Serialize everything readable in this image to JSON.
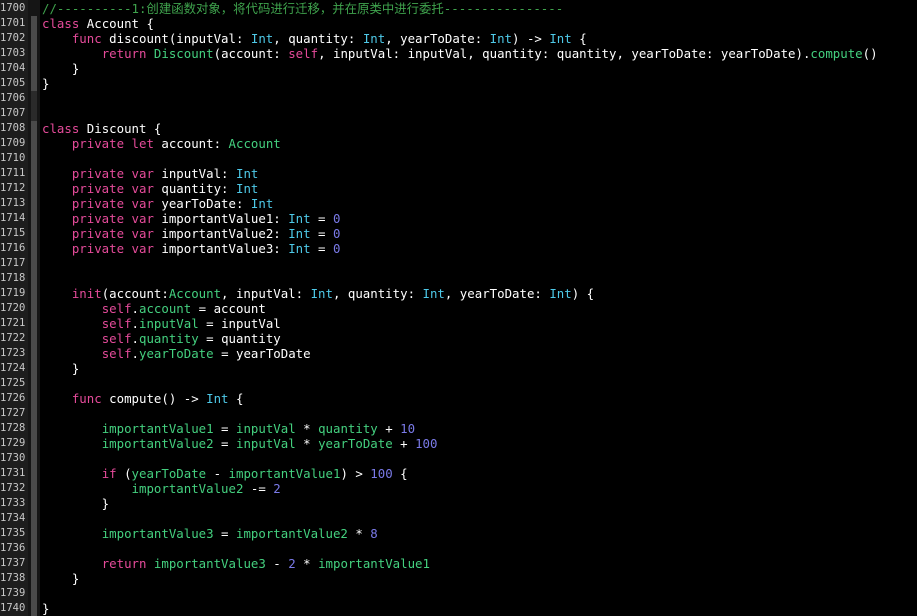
{
  "editor": {
    "app_kind": "code-editor",
    "language": "Swift",
    "background_color": "#000000",
    "gutter_background_color": "#1d1d1d",
    "line_number_color": "#c8c8c8",
    "first_line_number": 1700,
    "last_line_number": 1740,
    "palette": {
      "comment": "#3fa34d",
      "keyword": "#e54b9a",
      "type": "#4ec9e8",
      "identifier": "#44d07f",
      "number": "#7a7ae8",
      "plain": "#ffffff"
    }
  },
  "lines": [
    {
      "number": 1700,
      "fold": "none",
      "tokens": [
        {
          "t": "//----------1:创建函数对象，将代码进行迁移，并在原类中进行委托----------------",
          "c": "t-comment"
        }
      ]
    },
    {
      "number": 1701,
      "fold": "light",
      "tokens": [
        {
          "t": "class",
          "c": "t-keyword"
        },
        {
          "t": " ",
          "c": "t-plain"
        },
        {
          "t": "Account",
          "c": "t-plain"
        },
        {
          "t": " {",
          "c": "t-plain"
        }
      ]
    },
    {
      "number": 1702,
      "fold": "light",
      "tokens": [
        {
          "t": "    ",
          "c": "t-plain"
        },
        {
          "t": "func",
          "c": "t-keyword"
        },
        {
          "t": " discount(inputVal: ",
          "c": "t-plain"
        },
        {
          "t": "Int",
          "c": "t-type"
        },
        {
          "t": ", quantity: ",
          "c": "t-plain"
        },
        {
          "t": "Int",
          "c": "t-type"
        },
        {
          "t": ", yearToDate: ",
          "c": "t-plain"
        },
        {
          "t": "Int",
          "c": "t-type"
        },
        {
          "t": ") -> ",
          "c": "t-plain"
        },
        {
          "t": "Int",
          "c": "t-type"
        },
        {
          "t": " {",
          "c": "t-plain"
        }
      ]
    },
    {
      "number": 1703,
      "fold": "light",
      "tokens": [
        {
          "t": "        ",
          "c": "t-plain"
        },
        {
          "t": "return",
          "c": "t-keyword"
        },
        {
          "t": " ",
          "c": "t-plain"
        },
        {
          "t": "Discount",
          "c": "t-class"
        },
        {
          "t": "(account: ",
          "c": "t-plain"
        },
        {
          "t": "self",
          "c": "t-self"
        },
        {
          "t": ", inputVal: inputVal, quantity: quantity, yearToDate: yearToDate).",
          "c": "t-plain"
        },
        {
          "t": "compute",
          "c": "t-method"
        },
        {
          "t": "()",
          "c": "t-plain"
        }
      ]
    },
    {
      "number": 1704,
      "fold": "light",
      "tokens": [
        {
          "t": "    }",
          "c": "t-plain"
        }
      ]
    },
    {
      "number": 1705,
      "fold": "light",
      "tokens": [
        {
          "t": "}",
          "c": "t-plain"
        }
      ]
    },
    {
      "number": 1706,
      "fold": "dark",
      "tokens": []
    },
    {
      "number": 1707,
      "fold": "dark",
      "tokens": []
    },
    {
      "number": 1708,
      "fold": "light",
      "tokens": [
        {
          "t": "class",
          "c": "t-keyword"
        },
        {
          "t": " ",
          "c": "t-plain"
        },
        {
          "t": "Discount",
          "c": "t-plain"
        },
        {
          "t": " {",
          "c": "t-plain"
        }
      ]
    },
    {
      "number": 1709,
      "fold": "light",
      "tokens": [
        {
          "t": "    ",
          "c": "t-plain"
        },
        {
          "t": "private",
          "c": "t-keyword"
        },
        {
          "t": " ",
          "c": "t-plain"
        },
        {
          "t": "let",
          "c": "t-keyword"
        },
        {
          "t": " account: ",
          "c": "t-plain"
        },
        {
          "t": "Account",
          "c": "t-class"
        }
      ]
    },
    {
      "number": 1710,
      "fold": "light",
      "tokens": []
    },
    {
      "number": 1711,
      "fold": "light",
      "tokens": [
        {
          "t": "    ",
          "c": "t-plain"
        },
        {
          "t": "private",
          "c": "t-keyword"
        },
        {
          "t": " ",
          "c": "t-plain"
        },
        {
          "t": "var",
          "c": "t-keyword"
        },
        {
          "t": " inputVal: ",
          "c": "t-plain"
        },
        {
          "t": "Int",
          "c": "t-type"
        }
      ]
    },
    {
      "number": 1712,
      "fold": "light",
      "tokens": [
        {
          "t": "    ",
          "c": "t-plain"
        },
        {
          "t": "private",
          "c": "t-keyword"
        },
        {
          "t": " ",
          "c": "t-plain"
        },
        {
          "t": "var",
          "c": "t-keyword"
        },
        {
          "t": " quantity: ",
          "c": "t-plain"
        },
        {
          "t": "Int",
          "c": "t-type"
        }
      ]
    },
    {
      "number": 1713,
      "fold": "light",
      "tokens": [
        {
          "t": "    ",
          "c": "t-plain"
        },
        {
          "t": "private",
          "c": "t-keyword"
        },
        {
          "t": " ",
          "c": "t-plain"
        },
        {
          "t": "var",
          "c": "t-keyword"
        },
        {
          "t": " yearToDate: ",
          "c": "t-plain"
        },
        {
          "t": "Int",
          "c": "t-type"
        }
      ]
    },
    {
      "number": 1714,
      "fold": "light",
      "tokens": [
        {
          "t": "    ",
          "c": "t-plain"
        },
        {
          "t": "private",
          "c": "t-keyword"
        },
        {
          "t": " ",
          "c": "t-plain"
        },
        {
          "t": "var",
          "c": "t-keyword"
        },
        {
          "t": " importantValue1: ",
          "c": "t-plain"
        },
        {
          "t": "Int",
          "c": "t-type"
        },
        {
          "t": " = ",
          "c": "t-plain"
        },
        {
          "t": "0",
          "c": "t-num"
        }
      ]
    },
    {
      "number": 1715,
      "fold": "light",
      "tokens": [
        {
          "t": "    ",
          "c": "t-plain"
        },
        {
          "t": "private",
          "c": "t-keyword"
        },
        {
          "t": " ",
          "c": "t-plain"
        },
        {
          "t": "var",
          "c": "t-keyword"
        },
        {
          "t": " importantValue2: ",
          "c": "t-plain"
        },
        {
          "t": "Int",
          "c": "t-type"
        },
        {
          "t": " = ",
          "c": "t-plain"
        },
        {
          "t": "0",
          "c": "t-num"
        }
      ]
    },
    {
      "number": 1716,
      "fold": "light",
      "tokens": [
        {
          "t": "    ",
          "c": "t-plain"
        },
        {
          "t": "private",
          "c": "t-keyword"
        },
        {
          "t": " ",
          "c": "t-plain"
        },
        {
          "t": "var",
          "c": "t-keyword"
        },
        {
          "t": " importantValue3: ",
          "c": "t-plain"
        },
        {
          "t": "Int",
          "c": "t-type"
        },
        {
          "t": " = ",
          "c": "t-plain"
        },
        {
          "t": "0",
          "c": "t-num"
        }
      ]
    },
    {
      "number": 1717,
      "fold": "light",
      "tokens": []
    },
    {
      "number": 1718,
      "fold": "light",
      "tokens": []
    },
    {
      "number": 1719,
      "fold": "light",
      "tokens": [
        {
          "t": "    ",
          "c": "t-plain"
        },
        {
          "t": "init",
          "c": "t-keyword"
        },
        {
          "t": "(account:",
          "c": "t-plain"
        },
        {
          "t": "Account",
          "c": "t-class"
        },
        {
          "t": ", inputVal: ",
          "c": "t-plain"
        },
        {
          "t": "Int",
          "c": "t-type"
        },
        {
          "t": ", quantity: ",
          "c": "t-plain"
        },
        {
          "t": "Int",
          "c": "t-type"
        },
        {
          "t": ", yearToDate: ",
          "c": "t-plain"
        },
        {
          "t": "Int",
          "c": "t-type"
        },
        {
          "t": ") {",
          "c": "t-plain"
        }
      ]
    },
    {
      "number": 1720,
      "fold": "light",
      "tokens": [
        {
          "t": "        ",
          "c": "t-plain"
        },
        {
          "t": "self",
          "c": "t-self"
        },
        {
          "t": ".",
          "c": "t-plain"
        },
        {
          "t": "account",
          "c": "t-ident"
        },
        {
          "t": " = account",
          "c": "t-plain"
        }
      ]
    },
    {
      "number": 1721,
      "fold": "light",
      "tokens": [
        {
          "t": "        ",
          "c": "t-plain"
        },
        {
          "t": "self",
          "c": "t-self"
        },
        {
          "t": ".",
          "c": "t-plain"
        },
        {
          "t": "inputVal",
          "c": "t-ident"
        },
        {
          "t": " = inputVal",
          "c": "t-plain"
        }
      ]
    },
    {
      "number": 1722,
      "fold": "light",
      "tokens": [
        {
          "t": "        ",
          "c": "t-plain"
        },
        {
          "t": "self",
          "c": "t-self"
        },
        {
          "t": ".",
          "c": "t-plain"
        },
        {
          "t": "quantity",
          "c": "t-ident"
        },
        {
          "t": " = quantity",
          "c": "t-plain"
        }
      ]
    },
    {
      "number": 1723,
      "fold": "light",
      "tokens": [
        {
          "t": "        ",
          "c": "t-plain"
        },
        {
          "t": "self",
          "c": "t-self"
        },
        {
          "t": ".",
          "c": "t-plain"
        },
        {
          "t": "yearToDate",
          "c": "t-ident"
        },
        {
          "t": " = yearToDate",
          "c": "t-plain"
        }
      ]
    },
    {
      "number": 1724,
      "fold": "light",
      "tokens": [
        {
          "t": "    }",
          "c": "t-plain"
        }
      ]
    },
    {
      "number": 1725,
      "fold": "light",
      "tokens": []
    },
    {
      "number": 1726,
      "fold": "light",
      "tokens": [
        {
          "t": "    ",
          "c": "t-plain"
        },
        {
          "t": "func",
          "c": "t-keyword"
        },
        {
          "t": " compute() -> ",
          "c": "t-plain"
        },
        {
          "t": "Int",
          "c": "t-type"
        },
        {
          "t": " {",
          "c": "t-plain"
        }
      ]
    },
    {
      "number": 1727,
      "fold": "light",
      "tokens": []
    },
    {
      "number": 1728,
      "fold": "light",
      "tokens": [
        {
          "t": "        ",
          "c": "t-plain"
        },
        {
          "t": "importantValue1",
          "c": "t-ident"
        },
        {
          "t": " = ",
          "c": "t-plain"
        },
        {
          "t": "inputVal",
          "c": "t-ident"
        },
        {
          "t": " * ",
          "c": "t-plain"
        },
        {
          "t": "quantity",
          "c": "t-ident"
        },
        {
          "t": " + ",
          "c": "t-plain"
        },
        {
          "t": "10",
          "c": "t-num"
        }
      ]
    },
    {
      "number": 1729,
      "fold": "light",
      "tokens": [
        {
          "t": "        ",
          "c": "t-plain"
        },
        {
          "t": "importantValue2",
          "c": "t-ident"
        },
        {
          "t": " = ",
          "c": "t-plain"
        },
        {
          "t": "inputVal",
          "c": "t-ident"
        },
        {
          "t": " * ",
          "c": "t-plain"
        },
        {
          "t": "yearToDate",
          "c": "t-ident"
        },
        {
          "t": " + ",
          "c": "t-plain"
        },
        {
          "t": "100",
          "c": "t-num"
        }
      ]
    },
    {
      "number": 1730,
      "fold": "light",
      "tokens": []
    },
    {
      "number": 1731,
      "fold": "light",
      "tokens": [
        {
          "t": "        ",
          "c": "t-plain"
        },
        {
          "t": "if",
          "c": "t-keyword"
        },
        {
          "t": " (",
          "c": "t-plain"
        },
        {
          "t": "yearToDate",
          "c": "t-ident"
        },
        {
          "t": " - ",
          "c": "t-plain"
        },
        {
          "t": "importantValue1",
          "c": "t-ident"
        },
        {
          "t": ") > ",
          "c": "t-plain"
        },
        {
          "t": "100",
          "c": "t-num"
        },
        {
          "t": " {",
          "c": "t-plain"
        }
      ]
    },
    {
      "number": 1732,
      "fold": "light",
      "tokens": [
        {
          "t": "            ",
          "c": "t-plain"
        },
        {
          "t": "importantValue2",
          "c": "t-ident"
        },
        {
          "t": " -= ",
          "c": "t-plain"
        },
        {
          "t": "2",
          "c": "t-num"
        }
      ]
    },
    {
      "number": 1733,
      "fold": "light",
      "tokens": [
        {
          "t": "        }",
          "c": "t-plain"
        }
      ]
    },
    {
      "number": 1734,
      "fold": "light",
      "tokens": []
    },
    {
      "number": 1735,
      "fold": "light",
      "tokens": [
        {
          "t": "        ",
          "c": "t-plain"
        },
        {
          "t": "importantValue3",
          "c": "t-ident"
        },
        {
          "t": " = ",
          "c": "t-plain"
        },
        {
          "t": "importantValue2",
          "c": "t-ident"
        },
        {
          "t": " * ",
          "c": "t-plain"
        },
        {
          "t": "8",
          "c": "t-num"
        }
      ]
    },
    {
      "number": 1736,
      "fold": "light",
      "tokens": []
    },
    {
      "number": 1737,
      "fold": "light",
      "tokens": [
        {
          "t": "        ",
          "c": "t-plain"
        },
        {
          "t": "return",
          "c": "t-keyword"
        },
        {
          "t": " ",
          "c": "t-plain"
        },
        {
          "t": "importantValue3",
          "c": "t-ident"
        },
        {
          "t": " - ",
          "c": "t-plain"
        },
        {
          "t": "2",
          "c": "t-num"
        },
        {
          "t": " * ",
          "c": "t-plain"
        },
        {
          "t": "importantValue1",
          "c": "t-ident"
        }
      ]
    },
    {
      "number": 1738,
      "fold": "light",
      "tokens": [
        {
          "t": "    }",
          "c": "t-plain"
        }
      ]
    },
    {
      "number": 1739,
      "fold": "light",
      "tokens": []
    },
    {
      "number": 1740,
      "fold": "light",
      "tokens": [
        {
          "t": "}",
          "c": "t-plain"
        }
      ]
    }
  ]
}
